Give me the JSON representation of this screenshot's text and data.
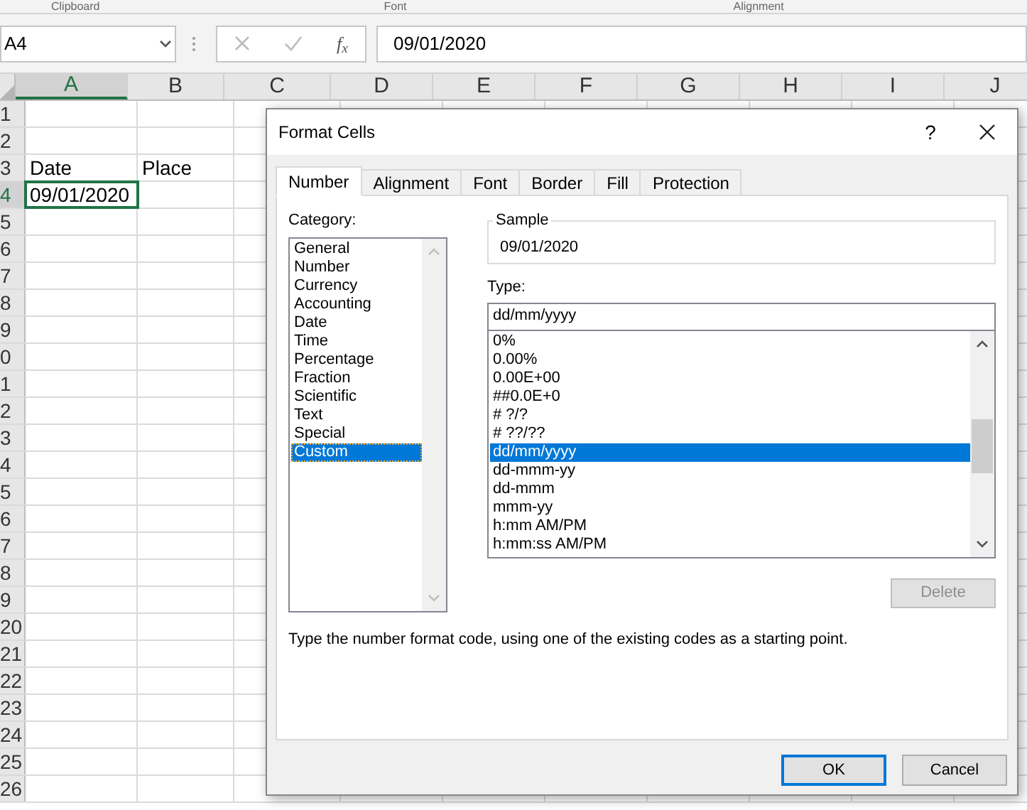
{
  "ribbon_groups": [
    "Clipboard",
    "Font",
    "Alignment"
  ],
  "name_box": "A4",
  "fx_label": "f$_{x}$",
  "formula_value": "09/01/2020",
  "columns": [
    {
      "label": "A",
      "selected": true
    },
    {
      "label": "B",
      "selected": false
    },
    {
      "label": "C",
      "selected": false
    },
    {
      "label": "D",
      "selected": false
    },
    {
      "label": "E",
      "selected": false
    },
    {
      "label": "F",
      "selected": false
    },
    {
      "label": "G",
      "selected": false
    },
    {
      "label": "H",
      "selected": false
    },
    {
      "label": "I",
      "selected": false
    },
    {
      "label": "J",
      "selected": false
    }
  ],
  "rows": [
    {
      "label": "1",
      "selected": false,
      "cells": []
    },
    {
      "label": "2",
      "selected": false,
      "cells": []
    },
    {
      "label": "3",
      "selected": false,
      "cells": [
        {
          "value": "Date",
          "selected": false
        },
        {
          "value": "Place",
          "selected": false
        }
      ]
    },
    {
      "label": "4",
      "selected": true,
      "cells": [
        {
          "value": "09/01/2020",
          "selected": true
        }
      ]
    },
    {
      "label": "5",
      "selected": false,
      "cells": []
    },
    {
      "label": "6",
      "selected": false,
      "cells": []
    },
    {
      "label": "7",
      "selected": false,
      "cells": []
    },
    {
      "label": "8",
      "selected": false,
      "cells": []
    },
    {
      "label": "9",
      "selected": false,
      "cells": []
    },
    {
      "label": "0",
      "selected": false,
      "cells": []
    },
    {
      "label": "1",
      "selected": false,
      "cells": []
    },
    {
      "label": "2",
      "selected": false,
      "cells": []
    },
    {
      "label": "3",
      "selected": false,
      "cells": []
    },
    {
      "label": "4",
      "selected": false,
      "cells": []
    },
    {
      "label": "5",
      "selected": false,
      "cells": []
    },
    {
      "label": "6",
      "selected": false,
      "cells": []
    },
    {
      "label": "7",
      "selected": false,
      "cells": []
    },
    {
      "label": "8",
      "selected": false,
      "cells": []
    },
    {
      "label": "9",
      "selected": false,
      "cells": []
    },
    {
      "label": "20",
      "selected": false,
      "cells": []
    },
    {
      "label": "21",
      "selected": false,
      "cells": []
    },
    {
      "label": "22",
      "selected": false,
      "cells": []
    },
    {
      "label": "23",
      "selected": false,
      "cells": []
    },
    {
      "label": "24",
      "selected": false,
      "cells": []
    },
    {
      "label": "25",
      "selected": false,
      "cells": []
    },
    {
      "label": "26",
      "selected": false,
      "cells": []
    }
  ],
  "dialog": {
    "title": "Format Cells",
    "help": "?",
    "tabs": [
      {
        "label": "Number",
        "selected": true
      },
      {
        "label": "Alignment",
        "selected": false
      },
      {
        "label": "Font",
        "selected": false
      },
      {
        "label": "Border",
        "selected": false
      },
      {
        "label": "Fill",
        "selected": false
      },
      {
        "label": "Protection",
        "selected": false
      }
    ],
    "category_label": "Category:",
    "categories": [
      {
        "label": "General",
        "selected": false
      },
      {
        "label": "Number",
        "selected": false
      },
      {
        "label": "Currency",
        "selected": false
      },
      {
        "label": "Accounting",
        "selected": false
      },
      {
        "label": "Date",
        "selected": false
      },
      {
        "label": "Time",
        "selected": false
      },
      {
        "label": "Percentage",
        "selected": false
      },
      {
        "label": "Fraction",
        "selected": false
      },
      {
        "label": "Scientific",
        "selected": false
      },
      {
        "label": "Text",
        "selected": false
      },
      {
        "label": "Special",
        "selected": false
      },
      {
        "label": "Custom",
        "selected": true
      }
    ],
    "sample_label": "Sample",
    "sample_value": "09/01/2020",
    "type_label": "Type:",
    "type_value": "dd/mm/yyyy",
    "type_options": [
      {
        "label": "0%",
        "selected": false
      },
      {
        "label": "0.00%",
        "selected": false
      },
      {
        "label": "0.00E+00",
        "selected": false
      },
      {
        "label": "##0.0E+0",
        "selected": false
      },
      {
        "label": "# ?/?",
        "selected": false
      },
      {
        "label": "# ??/??",
        "selected": false
      },
      {
        "label": "dd/mm/yyyy",
        "selected": true
      },
      {
        "label": "dd-mmm-yy",
        "selected": false
      },
      {
        "label": "dd-mmm",
        "selected": false
      },
      {
        "label": "mmm-yy",
        "selected": false
      },
      {
        "label": "h:mm AM/PM",
        "selected": false
      },
      {
        "label": "h:mm:ss AM/PM",
        "selected": false
      }
    ],
    "delete_button": {
      "label": "Delete",
      "disabled": true
    },
    "description": "Type the number format code, using one of the existing codes as a starting point.",
    "buttons": [
      {
        "label": "OK",
        "default": true
      },
      {
        "label": "Cancel",
        "default": false
      }
    ]
  }
}
